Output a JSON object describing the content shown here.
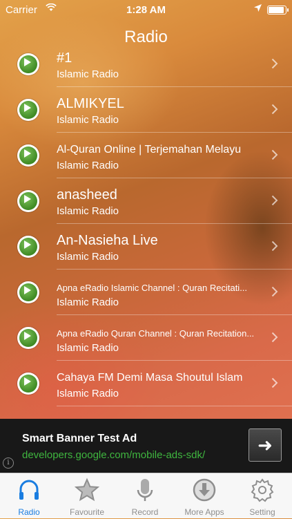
{
  "status": {
    "carrier": "Carrier",
    "time": "1:28 AM"
  },
  "nav": {
    "title": "Radio"
  },
  "stations": [
    {
      "name": "#1",
      "category": "Islamic Radio",
      "size": "big"
    },
    {
      "name": "ALMIKYEL",
      "category": "Islamic Radio",
      "size": "big"
    },
    {
      "name": "Al-Quran Online | Terjemahan Melayu",
      "category": "Islamic Radio",
      "size": "mid"
    },
    {
      "name": "anasheed",
      "category": "Islamic Radio",
      "size": "big"
    },
    {
      "name": "An-Nasieha Live",
      "category": "Islamic Radio",
      "size": "big"
    },
    {
      "name": "Apna eRadio Islamic Channel : Quran Recitati...",
      "category": "Islamic Radio",
      "size": "small"
    },
    {
      "name": "Apna eRadio Quran Channel : Quran Recitation...",
      "category": "Islamic Radio",
      "size": "small"
    },
    {
      "name": "Cahaya FM Demi Masa Shoutul Islam",
      "category": "Islamic Radio",
      "size": "mid"
    }
  ],
  "ad": {
    "title": "Smart Banner Test Ad",
    "url": "developers.google.com/mobile-ads-sdk/",
    "info": "i"
  },
  "tabs": [
    {
      "label": "Radio",
      "icon": "headphones-icon",
      "active": true
    },
    {
      "label": "Favourite",
      "icon": "star-icon",
      "active": false
    },
    {
      "label": "Record",
      "icon": "microphone-icon",
      "active": false
    },
    {
      "label": "More Apps",
      "icon": "download-icon",
      "active": false
    },
    {
      "label": "Setting",
      "icon": "gear-icon",
      "active": false
    }
  ],
  "colors": {
    "accent": "#1a7de0",
    "play": "#4a9a2e",
    "ad_url": "#3fb63f"
  }
}
